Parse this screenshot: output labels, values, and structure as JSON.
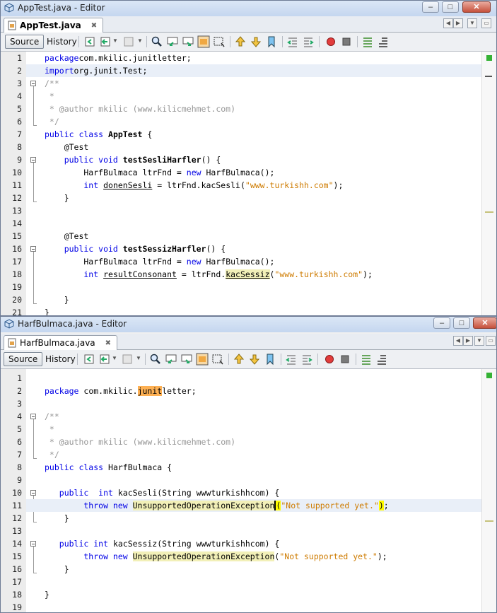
{
  "windows": [
    {
      "title": "AppTest.java - Editor",
      "tab_label": "AppTest.java",
      "toolbar": {
        "source_label": "Source",
        "history_label": "History"
      },
      "code_lines": [
        {
          "n": "1",
          "segs": [
            [
              "kw",
              "package"
            ],
            [
              "",
              "com.mkilic.junitletter;"
            ]
          ]
        },
        {
          "n": "2",
          "hl": true,
          "segs": [
            [
              "kw",
              "import"
            ],
            [
              "",
              "org.junit.Test;"
            ]
          ]
        },
        {
          "n": "3",
          "segs": [
            [
              "cm",
              "/**"
            ]
          ]
        },
        {
          "n": "4",
          "segs": [
            [
              "cm",
              " *"
            ]
          ]
        },
        {
          "n": "5",
          "segs": [
            [
              "cm",
              " * @author mkilic (www.kilicmehmet.com)"
            ]
          ]
        },
        {
          "n": "6",
          "segs": [
            [
              "cm",
              " */"
            ]
          ]
        },
        {
          "n": "7",
          "segs": [
            [
              "kw",
              "public class "
            ],
            [
              "bold",
              "AppTest"
            ],
            [
              "",
              " {"
            ]
          ]
        },
        {
          "n": "8",
          "segs": [
            [
              "",
              "    @Test"
            ]
          ]
        },
        {
          "n": "9",
          "segs": [
            [
              "kw",
              "    public void "
            ],
            [
              "bold",
              "testSesliHarfler"
            ],
            [
              "",
              "() {"
            ]
          ]
        },
        {
          "n": "10",
          "segs": [
            [
              "",
              "        HarfBulmaca ltrFnd = "
            ],
            [
              "kw",
              "new"
            ],
            [
              "",
              " HarfBulmaca();"
            ]
          ]
        },
        {
          "n": "11",
          "segs": [
            [
              "kw",
              "        int "
            ],
            [
              "ul",
              "donenSesli"
            ],
            [
              "",
              " = ltrFnd.kacSesli("
            ],
            [
              "st",
              "\"www.turkishh.com\""
            ],
            [
              "",
              ");"
            ]
          ]
        },
        {
          "n": "12",
          "segs": [
            [
              "",
              "    }"
            ]
          ]
        },
        {
          "n": "13",
          "segs": []
        },
        {
          "n": "14",
          "segs": []
        },
        {
          "n": "15",
          "segs": [
            [
              "",
              "    @Test"
            ]
          ]
        },
        {
          "n": "16",
          "segs": [
            [
              "kw",
              "    public void "
            ],
            [
              "bold",
              "testSessizHarfler"
            ],
            [
              "",
              "() {"
            ]
          ]
        },
        {
          "n": "17",
          "segs": [
            [
              "",
              "        HarfBulmaca ltrFnd = "
            ],
            [
              "kw",
              "new"
            ],
            [
              "",
              " HarfBulmaca();"
            ]
          ]
        },
        {
          "n": "18",
          "segs": [
            [
              "kw",
              "        int "
            ],
            [
              "ul",
              "resultConsonant"
            ],
            [
              "",
              " = ltrFnd."
            ],
            [
              "occ ul",
              "kacSessiz"
            ],
            [
              "",
              "("
            ],
            [
              "st",
              "\"www.turkishh.com\""
            ],
            [
              "",
              ");"
            ]
          ]
        },
        {
          "n": "19",
          "segs": []
        },
        {
          "n": "20",
          "segs": [
            [
              "",
              "    }"
            ]
          ]
        },
        {
          "n": "21",
          "segs": [
            [
              "",
              "}"
            ]
          ]
        }
      ]
    },
    {
      "title": "HarfBulmaca.java - Editor",
      "tab_label": "HarfBulmaca.java",
      "toolbar": {
        "source_label": "Source",
        "history_label": "History"
      },
      "code_lines": [
        {
          "n": "1",
          "segs": []
        },
        {
          "n": "2",
          "segs": [
            [
              "kw",
              "package"
            ],
            [
              "",
              " com.mkilic."
            ],
            [
              "occ2",
              "junit"
            ],
            [
              "",
              "letter;"
            ]
          ]
        },
        {
          "n": "3",
          "segs": []
        },
        {
          "n": "4",
          "segs": [
            [
              "cm",
              "/**"
            ]
          ]
        },
        {
          "n": "5",
          "segs": [
            [
              "cm",
              " *"
            ]
          ]
        },
        {
          "n": "6",
          "segs": [
            [
              "cm",
              " * @author mkilic (www.kilicmehmet.com)"
            ]
          ]
        },
        {
          "n": "7",
          "segs": [
            [
              "cm",
              " */"
            ]
          ]
        },
        {
          "n": "8",
          "segs": [
            [
              "kw",
              "public class "
            ],
            [
              "",
              "HarfBulmaca {"
            ]
          ]
        },
        {
          "n": "9",
          "segs": []
        },
        {
          "n": "10",
          "segs": [
            [
              "kw",
              "   public  int "
            ],
            [
              "",
              "kacSesli(String wwwturkishhcom) {"
            ]
          ]
        },
        {
          "n": "11",
          "hl": true,
          "segs": [
            [
              "kw",
              "        throw new "
            ],
            [
              "occ",
              "UnsupportedOperationException"
            ],
            [
              "brk caret",
              "("
            ],
            [
              "st",
              "\"Not supported yet.\""
            ],
            [
              "brk",
              ")"
            ],
            [
              "",
              ";"
            ]
          ]
        },
        {
          "n": "12",
          "segs": [
            [
              "",
              "    }"
            ]
          ]
        },
        {
          "n": "13",
          "segs": []
        },
        {
          "n": "14",
          "segs": [
            [
              "kw",
              "   public int "
            ],
            [
              "",
              "kacSessiz(String wwwturkishhcom) {"
            ]
          ]
        },
        {
          "n": "15",
          "segs": [
            [
              "kw",
              "        throw new "
            ],
            [
              "occ",
              "UnsupportedOperationException"
            ],
            [
              "",
              "("
            ],
            [
              "st",
              "\"Not supported yet.\""
            ],
            [
              "",
              ");"
            ]
          ]
        },
        {
          "n": "16",
          "segs": [
            [
              "",
              "    }"
            ]
          ]
        },
        {
          "n": "17",
          "segs": []
        },
        {
          "n": "18",
          "segs": [
            [
              "",
              "}"
            ]
          ]
        },
        {
          "n": "19",
          "segs": []
        }
      ]
    }
  ]
}
